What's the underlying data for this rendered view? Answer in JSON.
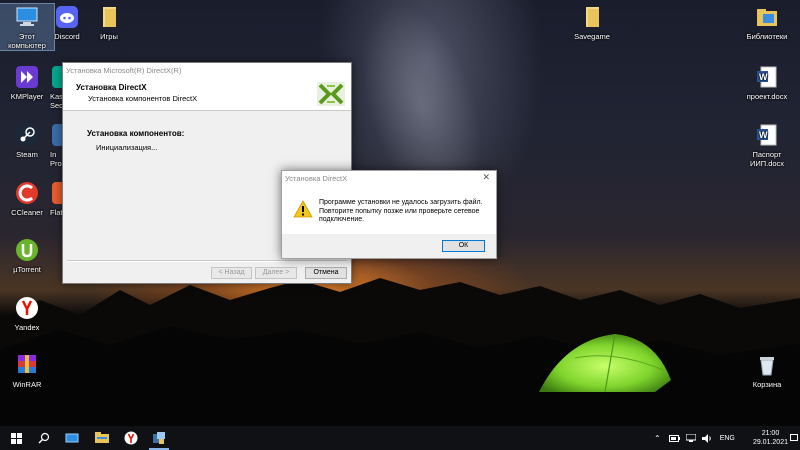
{
  "desktop": {
    "icons_left": [
      {
        "label": "Этот компьютер",
        "icon": "computer-icon"
      },
      {
        "label": "Discord",
        "icon": "discord-icon"
      },
      {
        "label": "Игры",
        "icon": "folder-icon"
      },
      {
        "label": "KMPlayer",
        "icon": "kmplayer-icon"
      },
      {
        "label": "Kas Secu",
        "icon": "kaspersky-icon"
      },
      {
        "label": "Steam",
        "icon": "steam-icon"
      },
      {
        "label": "In Proce",
        "icon": "app-icon"
      },
      {
        "label": "CCleaner",
        "icon": "ccleaner-icon"
      },
      {
        "label": "Flat",
        "icon": "app-icon"
      },
      {
        "label": "µTorrent",
        "icon": "utorrent-icon"
      },
      {
        "label": "Yandex",
        "icon": "yandex-icon"
      },
      {
        "label": "WinRAR",
        "icon": "winrar-icon"
      }
    ],
    "icons_right": [
      {
        "label": "Savegame",
        "icon": "folder-icon"
      },
      {
        "label": "Библиотеки",
        "icon": "libraries-icon"
      },
      {
        "label": "проект.docx",
        "icon": "word-document-icon"
      },
      {
        "label": "Паспорт ИИП.docx",
        "icon": "word-document-icon"
      },
      {
        "label": "Корзина",
        "icon": "recycle-bin-icon"
      }
    ]
  },
  "installer": {
    "title": "Установка Microsoft(R) DirectX(R)",
    "header_title": "Установка DirectX",
    "header_subtitle": "Установка компонентов DirectX",
    "section_title": "Установка компонентов:",
    "status": "Инициализация...",
    "back_label": "< Назад",
    "next_label": "Далее >",
    "cancel_label": "Отмена"
  },
  "dialog": {
    "title": "Установка DirectX",
    "close_glyph": "✕",
    "message": "Программе установки не удалось загрузить файл. Повторите попытку позже или проверьте сетевое подключение.",
    "ok_label": "ОК"
  },
  "taskbar": {
    "language": "ENG",
    "time": "21:00",
    "date": "29.01.2021",
    "tray_chevron": "⌃"
  },
  "colors": {
    "accent": "#0078d7",
    "tent_green": "#8fe03a",
    "sunset": "#ff8c28"
  }
}
